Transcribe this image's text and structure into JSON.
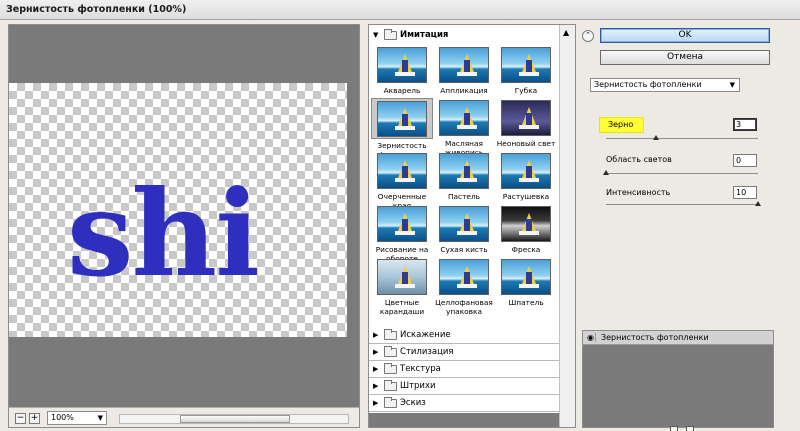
{
  "window": {
    "title": "Зернистость фотопленки (100%)"
  },
  "preview": {
    "sample_text": "shi",
    "zoom": "100%",
    "zoom_out": "−",
    "zoom_in": "+"
  },
  "gallery": {
    "categories": [
      {
        "label": "Имитация",
        "expanded": true
      },
      {
        "label": "Искажение"
      },
      {
        "label": "Стилизация"
      },
      {
        "label": "Текстура"
      },
      {
        "label": "Штрихи"
      },
      {
        "label": "Эскиз"
      }
    ],
    "filters": [
      "Акварель",
      "Аппликация",
      "Губка",
      "Зернистость фотопленки",
      "Масляная живопись",
      "Неоновый свет",
      "Очерченные края",
      "Пастель",
      "Растушевка",
      "Рисование на обороте",
      "Сухая кисть",
      "Фреска",
      "Цветные карандаши",
      "Целлофановая упаковка",
      "Шпатель"
    ],
    "selected": "Зернистость фотопленки"
  },
  "buttons": {
    "ok": "OK",
    "cancel": "Отмена"
  },
  "filter_select": "Зернистость фотопленки",
  "params": {
    "grain": {
      "label": "Зерно",
      "value": "3",
      "level": 0.33
    },
    "highlight_area": {
      "label": "Область светов",
      "value": "0",
      "level": 0
    },
    "intensity": {
      "label": "Интенсивность",
      "value": "10",
      "level": 1
    }
  },
  "layers": {
    "items": [
      {
        "name": "Зернистость фотопленки"
      }
    ]
  },
  "icons": {
    "collapse": "collapse-icon",
    "eye": "eye-icon",
    "new_layer": "new-effect-layer-icon",
    "delete_layer": "delete-effect-layer-icon"
  }
}
